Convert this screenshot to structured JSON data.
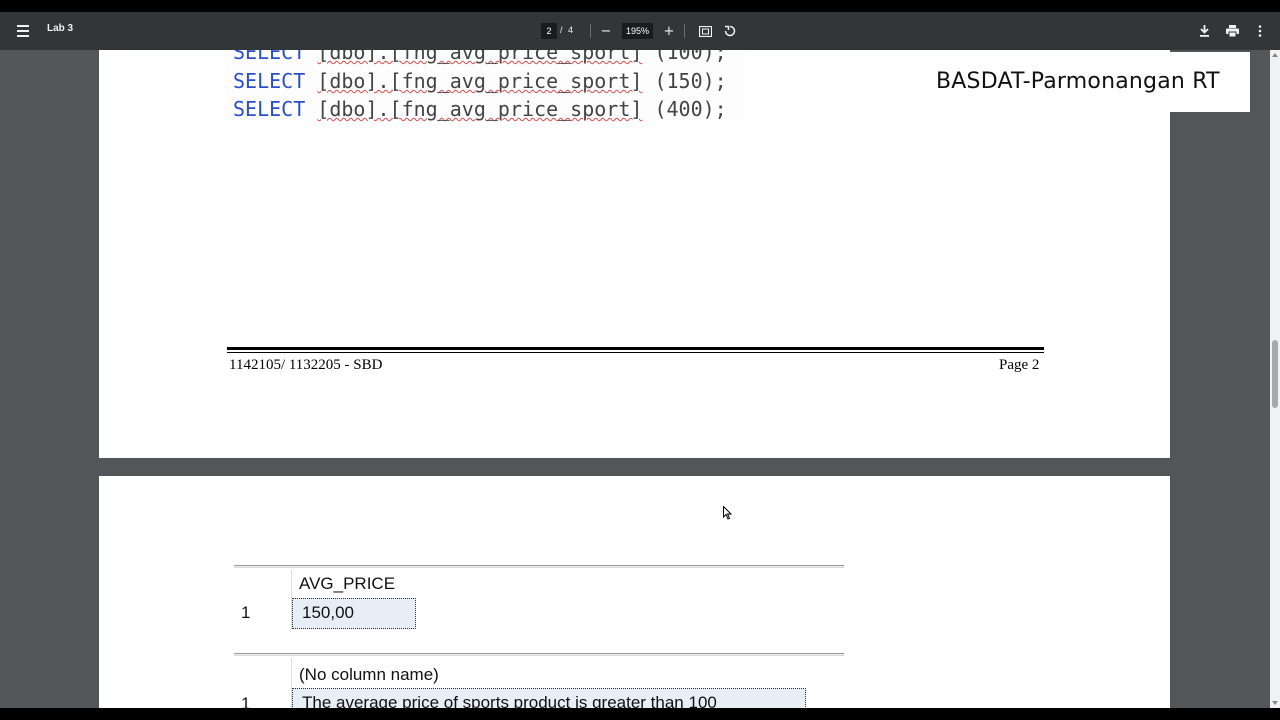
{
  "toolbar": {
    "title": "Lab 3",
    "current_page": "2",
    "page_separator": "/",
    "total_pages": "4",
    "zoom": "195%",
    "zoom_out_icon": "minus-icon",
    "zoom_in_icon": "plus-icon",
    "fit_icon": "fit-page-icon",
    "rotate_icon": "rotate-icon",
    "download_icon": "download-icon",
    "print_icon": "print-icon",
    "more_icon": "more-vert-icon"
  },
  "page1": {
    "code": [
      {
        "kw": "SELECT",
        "fn": "[dbo].[fng_avg_price_sport]",
        "arg": "(100);"
      },
      {
        "kw": "SELECT",
        "fn": "[dbo].[fng_avg_price_sport]",
        "arg": "(150);"
      },
      {
        "kw": "SELECT",
        "fn": "[dbo].[fng_avg_price_sport]",
        "arg": "(400);"
      }
    ],
    "footer_left": "1142105/ 1132205 - SBD",
    "footer_right": "Page 2"
  },
  "watermark": "BASDAT-Parmonangan RT",
  "page2": {
    "result1": {
      "header": "AVG_PRICE",
      "row_num": "1",
      "value": "150,00"
    },
    "result2": {
      "header": "(No column name)",
      "row_num": "1",
      "value": "The average price of sports product is greater than 100"
    }
  },
  "colors": {
    "toolbar": "#323639",
    "viewer_bg": "#525659",
    "keyword": "#2b4ecb"
  }
}
